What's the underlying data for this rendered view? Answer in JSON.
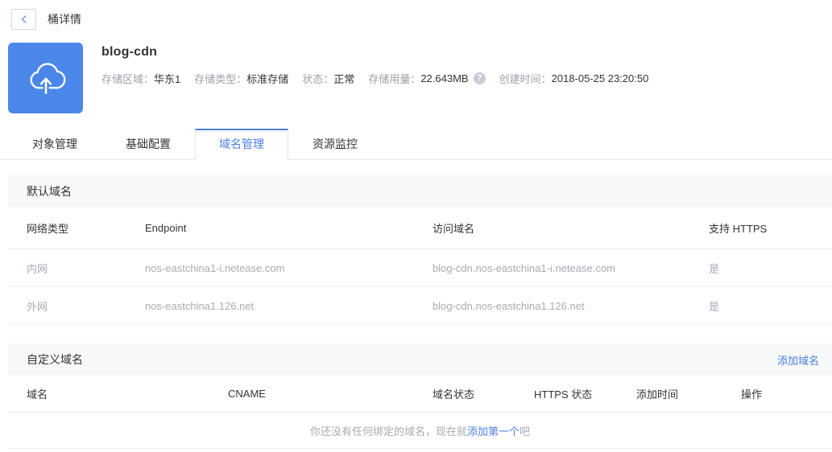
{
  "page": {
    "title": "桶详情"
  },
  "icons": {
    "back": "chevron-left",
    "bucket": "cloud-upload",
    "help": "question-mark",
    "help_glyph": "?"
  },
  "colors": {
    "accent_blue": "#4d7fe2",
    "icon_blue": "#4b87e9",
    "section_bg": "#f7f8fa"
  },
  "bucket": {
    "name": "blog-cdn",
    "info": [
      {
        "label": "存储区域：",
        "value": "华东1"
      },
      {
        "label": "存储类型：",
        "value": "标准存储"
      },
      {
        "label": "状态：",
        "value": "正常"
      },
      {
        "label": "存储用量：",
        "value": "22.643MB"
      },
      {
        "label": "创建时间：",
        "value": "2018-05-25 23:20:50"
      }
    ]
  },
  "tabs": [
    {
      "label": "对象管理",
      "active": false
    },
    {
      "label": "基础配置",
      "active": false
    },
    {
      "label": "域名管理",
      "active": true
    },
    {
      "label": "资源监控",
      "active": false
    }
  ],
  "default_domain": {
    "section_title": "默认域名",
    "columns": [
      "网络类型",
      "Endpoint",
      "访问域名",
      "支持 HTTPS"
    ],
    "rows": [
      [
        "内网",
        "nos-eastchina1-i.netease.com",
        "blog-cdn.nos-eastchina1-i.netease.com",
        "是"
      ],
      [
        "外网",
        "nos-eastchina1.126.net",
        "blog-cdn.nos-eastchina1.126.net",
        "是"
      ]
    ]
  },
  "custom_domain": {
    "section_title": "自定义域名",
    "add_link": "添加域名",
    "columns": [
      "域名",
      "CNAME",
      "域名状态",
      "HTTPS 状态",
      "添加时间",
      "操作"
    ],
    "empty": {
      "prefix": "你还没有任何绑定的域名，现在就",
      "link": "添加第一个",
      "suffix": "吧"
    }
  }
}
